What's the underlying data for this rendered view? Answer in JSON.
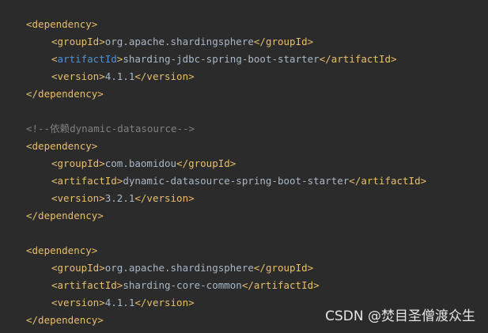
{
  "colors": {
    "background": "#2b2b2b",
    "tag": "#e8bf6a",
    "tag_highlighted": "#4f8fd6",
    "text": "#a9b7c6",
    "comment": "#808080",
    "watermark": "#e6e6e6"
  },
  "code": {
    "block1": {
      "open": "<dependency>",
      "group_open": "<groupId>",
      "group_value": "org.apache.shardingsphere",
      "group_close": "</groupId>",
      "artifact_open_lt": "<",
      "artifact_name": "artifactId",
      "artifact_open_gt": ">",
      "artifact_value": "sharding-jdbc-spring-boot-starter",
      "artifact_close": "</artifactId>",
      "version_open": "<version>",
      "version_value": "4.1.1",
      "version_close": "</version>",
      "close": "</dependency>"
    },
    "comment": "<!--依赖dynamic-datasource-->",
    "block2": {
      "open": "<dependency>",
      "group_open": "<groupId>",
      "group_value": "com.baomidou",
      "group_close": "</groupId>",
      "artifact_open": "<artifactId>",
      "artifact_value": "dynamic-datasource-spring-boot-starter",
      "artifact_close": "</artifactId>",
      "version_open": "<version>",
      "version_value": "3.2.1",
      "version_close": "</version>",
      "close": "</dependency>"
    },
    "block3": {
      "open": "<dependency>",
      "group_open": "<groupId>",
      "group_value": "org.apache.shardingsphere",
      "group_close": "</groupId>",
      "artifact_open": "<artifactId>",
      "artifact_value": "sharding-core-common",
      "artifact_close": "</artifactId>",
      "version_open": "<version>",
      "version_value": "4.1.1",
      "version_close": "</version>",
      "close": "</dependency>"
    }
  },
  "watermark": "CSDN @焚目圣僧渡众生"
}
